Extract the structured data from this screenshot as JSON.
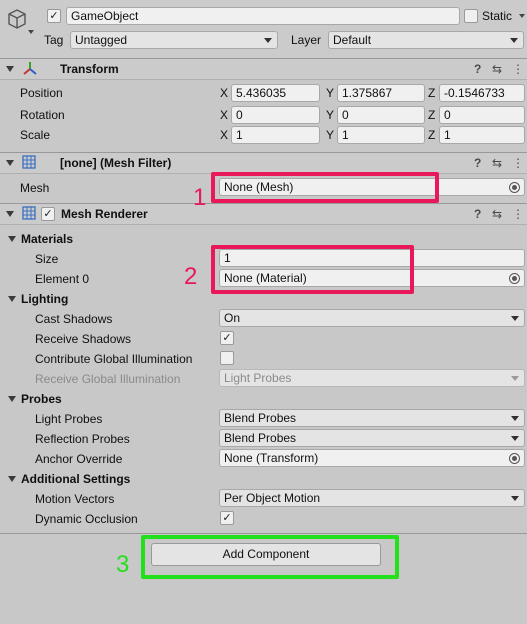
{
  "header": {
    "name": "GameObject",
    "active": "✓",
    "static_label": "Static",
    "tag_label": "Tag",
    "tag_value": "Untagged",
    "layer_label": "Layer",
    "layer_value": "Default"
  },
  "transform": {
    "title": "Transform",
    "position": {
      "label": "Position",
      "x": "5.436035",
      "y": "1.375867",
      "z": "-0.1546733"
    },
    "rotation": {
      "label": "Rotation",
      "x": "0",
      "y": "0",
      "z": "0"
    },
    "scale": {
      "label": "Scale",
      "x": "1",
      "y": "1",
      "z": "1"
    },
    "axis_x": "X",
    "axis_y": "Y",
    "axis_z": "Z"
  },
  "mesh_filter": {
    "title": "[none] (Mesh Filter)",
    "mesh_label": "Mesh",
    "mesh_value": "None (Mesh)"
  },
  "mesh_renderer": {
    "title": "Mesh Renderer",
    "enabled": "✓",
    "materials": {
      "section": "Materials",
      "size_label": "Size",
      "size_value": "1",
      "element0_label": "Element 0",
      "element0_value": "None (Material)"
    },
    "lighting": {
      "section": "Lighting",
      "cast_shadows_label": "Cast Shadows",
      "cast_shadows_value": "On",
      "receive_shadows_label": "Receive Shadows",
      "receive_shadows_checked": "✓",
      "contribute_gi_label": "Contribute Global Illumination",
      "receive_gi_label": "Receive Global Illumination",
      "receive_gi_value": "Light Probes"
    },
    "probes": {
      "section": "Probes",
      "light_probes_label": "Light Probes",
      "light_probes_value": "Blend Probes",
      "reflection_probes_label": "Reflection Probes",
      "reflection_probes_value": "Blend Probes",
      "anchor_override_label": "Anchor Override",
      "anchor_override_value": "None (Transform)"
    },
    "additional": {
      "section": "Additional Settings",
      "motion_vectors_label": "Motion Vectors",
      "motion_vectors_value": "Per Object Motion",
      "dynamic_occlusion_label": "Dynamic Occlusion",
      "dynamic_occlusion_checked": "✓"
    }
  },
  "add_component_label": "Add Component",
  "annotations": {
    "one": "1",
    "two": "2",
    "three": "3"
  },
  "header_icons": {
    "help": "?",
    "preset": "⇆",
    "menu": "⋮"
  },
  "colors": {
    "highlight_red": "#e8185a",
    "highlight_green": "#22e01c"
  }
}
